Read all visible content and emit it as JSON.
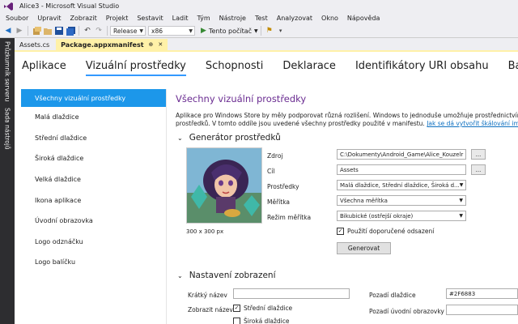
{
  "window": {
    "title": "Alice3 - Microsoft Visual Studio"
  },
  "menu": [
    "Soubor",
    "Upravit",
    "Zobrazit",
    "Projekt",
    "Sestavit",
    "Ladit",
    "Tým",
    "Nástroje",
    "Test",
    "Analyzovat",
    "Okno",
    "Nápověda"
  ],
  "toolbar": {
    "config": "Release",
    "platform": "x86",
    "run_label": "Tento počítač"
  },
  "left_tabs": [
    "Průzkumník serveru",
    "Sada nástrojů"
  ],
  "doc_tabs": {
    "inactive": "Assets.cs",
    "active": "Package.appxmanifest",
    "pin": "⊕",
    "close": "✕"
  },
  "main_tabs": [
    "Aplikace",
    "Vizuální prostředky",
    "Schopnosti",
    "Deklarace",
    "Identifikátory URI obsahu",
    "Balení"
  ],
  "sidenav": [
    "Všechny vizuální prostředky",
    "Malá dlaždice",
    "Střední dlaždice",
    "Široká dlaždice",
    "Velká dlaždice",
    "Ikona aplikace",
    "Úvodní obrazovka",
    "Logo odznáčku",
    "Logo balíčku"
  ],
  "content": {
    "title": "Všechny vizuální prostředky",
    "desc_line1": "Aplikace pro Windows Store by měly podporovat různá rozlišení. Windows to jednoduše umožňuje prostřednictvím načí",
    "desc_line2": "prostředků. V tomto oddíle jsou uvedené všechny prostředky použité v manifestu.",
    "desc_link": "Jak se dá vytvořit škálování image?",
    "generator": {
      "header": "Generátor prostředků",
      "caption": "300 x 300 px",
      "source_label": "Zdroj",
      "source_value": "C:\\Dokumenty\\Android_Game\\Alice_Kouzelr",
      "target_label": "Cíl",
      "target_value": "Assets",
      "assets_label": "Prostředky",
      "assets_value": "Malá dlaždice, Střední dlaždice, Široká d...",
      "scales_label": "Měřítka",
      "scales_value": "Všechna měřítka",
      "scalemode_label": "Režim měřítka",
      "scalemode_value": "Bikubické (ostřejší okraje)",
      "padding_label": "Použití doporučené odsazení",
      "browse": "...",
      "generate": "Generovat"
    },
    "display": {
      "header": "Nastavení zobrazení",
      "shortname_label": "Krátký název",
      "shortname_value": "",
      "showname_label": "Zobrazit název",
      "medium_label": "Střední dlaždice",
      "wide_label": "Široká dlaždice",
      "tilebg_label": "Pozadí dlaždice",
      "tilebg_value": "#2F6883",
      "splashbg_label": "Pozadí úvodní obrazovky",
      "splashbg_value": ""
    }
  },
  "colors": {
    "accent": "#1c97ea",
    "title_purple": "#6a2c91",
    "active_tab": "#fff1a8",
    "link": "#0e70c0"
  }
}
